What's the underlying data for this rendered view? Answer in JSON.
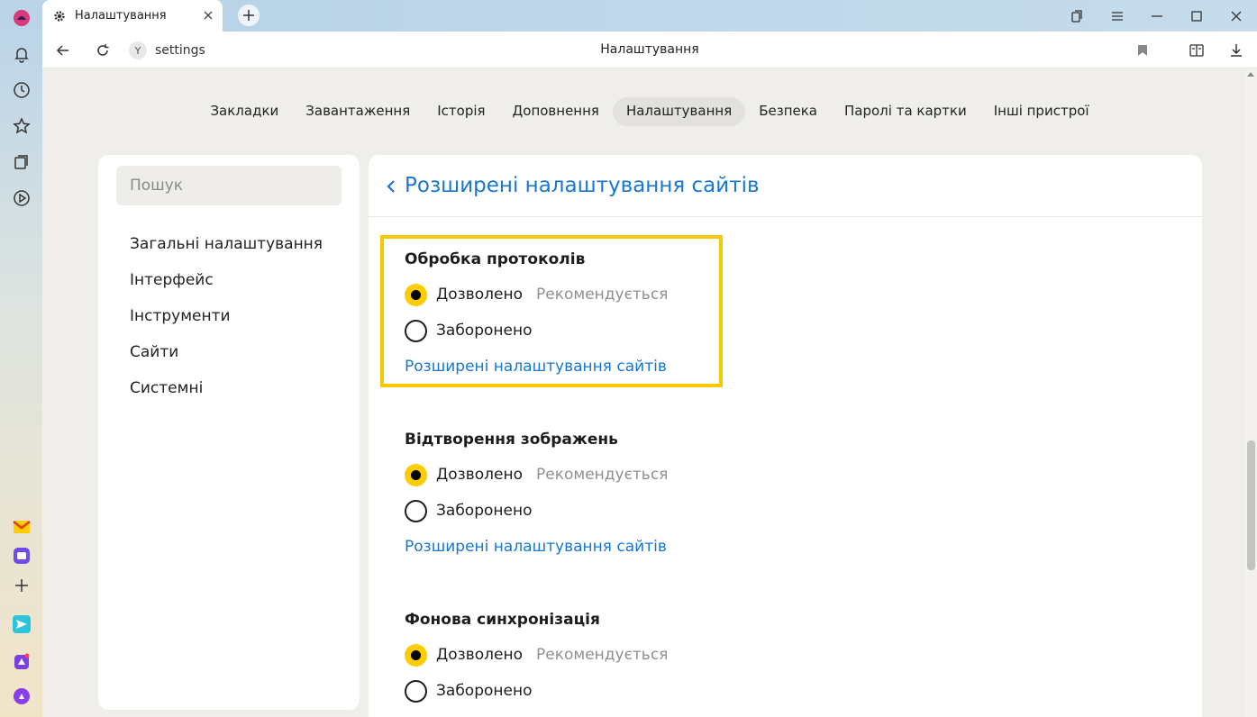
{
  "tab": {
    "title": "Налаштування"
  },
  "address": {
    "url": "settings",
    "page_title": "Налаштування"
  },
  "topnav": [
    {
      "label": "Закладки",
      "active": false
    },
    {
      "label": "Завантаження",
      "active": false
    },
    {
      "label": "Історія",
      "active": false
    },
    {
      "label": "Доповнення",
      "active": false
    },
    {
      "label": "Налаштування",
      "active": true
    },
    {
      "label": "Безпека",
      "active": false
    },
    {
      "label": "Паролі та картки",
      "active": false
    },
    {
      "label": "Інші пристрої",
      "active": false
    }
  ],
  "sidebar": {
    "search_placeholder": "Пошук",
    "items": [
      {
        "label": "Загальні налаштування"
      },
      {
        "label": "Інтерфейс"
      },
      {
        "label": "Інструменти"
      },
      {
        "label": "Сайти"
      },
      {
        "label": "Системні"
      }
    ]
  },
  "main": {
    "title": "Розширені налаштування сайтів",
    "sections": [
      {
        "title": "Обробка протоколів",
        "options": [
          {
            "label": "Дозволено",
            "note": "Рекомендується",
            "selected": true
          },
          {
            "label": "Заборонено",
            "note": "",
            "selected": false
          }
        ],
        "link": "Розширені налаштування сайтів"
      },
      {
        "title": "Відтворення зображень",
        "options": [
          {
            "label": "Дозволено",
            "note": "Рекомендується",
            "selected": true
          },
          {
            "label": "Заборонено",
            "note": "",
            "selected": false
          }
        ],
        "link": "Розширені налаштування сайтів"
      },
      {
        "title": "Фонова синхронізація",
        "options": [
          {
            "label": "Дозволено",
            "note": "Рекомендується",
            "selected": true
          },
          {
            "label": "Заборонено",
            "note": "",
            "selected": false
          }
        ]
      }
    ]
  },
  "colors": {
    "accent": "#ffcc00",
    "link": "#1976d2",
    "highlight": "#f5c800"
  },
  "icons": {
    "sidebar": [
      "alice-logo-icon",
      "bell-icon",
      "history-icon",
      "star-icon",
      "collections-icon",
      "play-icon",
      "mail-icon",
      "messenger-icon",
      "plus-icon",
      "send-icon",
      "lock-app-icon",
      "alice-icon"
    ]
  }
}
